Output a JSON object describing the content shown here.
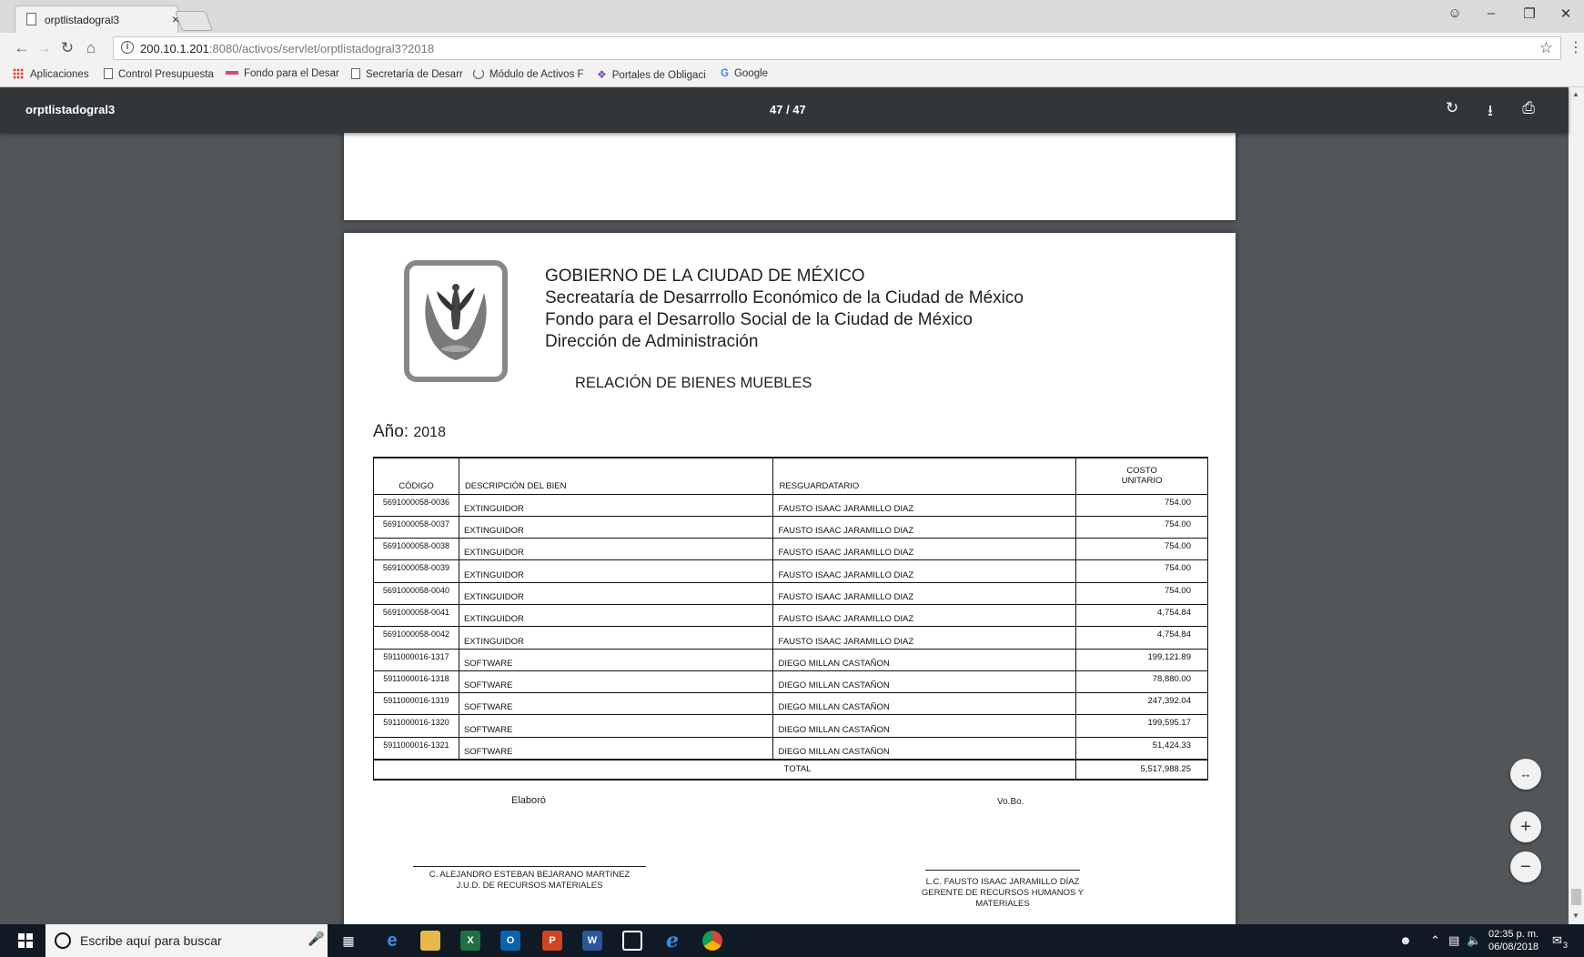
{
  "browser": {
    "tab_title": "orptlistadogral3",
    "tab_close": "×",
    "url_host": "200.10.1.201",
    "url_rest": ":8080/activos/servlet/orptlistadogral3?2018",
    "bookmarks": [
      {
        "label": "Aplicaciones",
        "icon": "apps-icon"
      },
      {
        "label": "Control Presupuesta",
        "icon": "page-icon"
      },
      {
        "label": "Fondo para el Desar",
        "icon": "fondeso-icon"
      },
      {
        "label": "Secretaría de Desarr",
        "icon": "page-icon"
      },
      {
        "label": "Módulo de Activos F",
        "icon": "loading-icon"
      },
      {
        "label": "Portales de Obligaci",
        "icon": "portal-icon"
      },
      {
        "label": "Google",
        "icon": "google-icon"
      }
    ]
  },
  "pdf": {
    "title": "orptlistadogral3",
    "page_indicator": "47 / 47"
  },
  "document": {
    "heading": [
      "GOBIERNO DE LA CIUDAD DE MÉXICO",
      "Secreataría de Desarrrollo Económico  de la Ciudad de México",
      "Fondo para el Desarrollo Social de la Ciudad de México",
      "Dirección de Administración"
    ],
    "report_title": "RELACIÓN DE BIENES MUEBLES",
    "year_label": "Año:",
    "year_value": "2018",
    "columns": {
      "code": "CÓDIGO",
      "description": "DESCRIPCIÓN DEL BIEN",
      "custodian": "RESGUARDATARIO",
      "cost_line1": "COSTO",
      "cost_line2": "UNITARIO"
    },
    "rows": [
      {
        "code": "5691000058-0036",
        "description": "EXTINGUIDOR",
        "custodian": "FAUSTO ISAAC JARAMILLO DIAZ",
        "cost": "754.00"
      },
      {
        "code": "5691000058-0037",
        "description": "EXTINGUIDOR",
        "custodian": "FAUSTO ISAAC JARAMILLO DIAZ",
        "cost": "754.00"
      },
      {
        "code": "5691000058-0038",
        "description": "EXTINGUIDOR",
        "custodian": "FAUSTO ISAAC JARAMILLO DIAZ",
        "cost": "754.00"
      },
      {
        "code": "5691000058-0039",
        "description": "EXTINGUIDOR",
        "custodian": "FAUSTO ISAAC JARAMILLO DIAZ",
        "cost": "754.00"
      },
      {
        "code": "5691000058-0040",
        "description": "EXTINGUIDOR",
        "custodian": "FAUSTO ISAAC JARAMILLO DIAZ",
        "cost": "754.00"
      },
      {
        "code": "5691000058-0041",
        "description": "EXTINGUIDOR",
        "custodian": "FAUSTO ISAAC JARAMILLO DIAZ",
        "cost": "4,754.84"
      },
      {
        "code": "5691000058-0042",
        "description": "EXTINGUIDOR",
        "custodian": "FAUSTO ISAAC JARAMILLO DIAZ",
        "cost": "4,754.84"
      },
      {
        "code": "5911000016-1317",
        "description": "SOFTWARE",
        "custodian": "DIEGO MILLAN CASTAÑON",
        "cost": "199,121.89"
      },
      {
        "code": "5911000016-1318",
        "description": "SOFTWARE",
        "custodian": "DIEGO MILLAN CASTAÑON",
        "cost": "78,880.00"
      },
      {
        "code": "5911000016-1319",
        "description": "SOFTWARE",
        "custodian": "DIEGO MILLAN CASTAÑON",
        "cost": "247,392.04"
      },
      {
        "code": "5911000016-1320",
        "description": "SOFTWARE",
        "custodian": "DIEGO MILLAN CASTAÑON",
        "cost": "199,595.17"
      },
      {
        "code": "5911000016-1321",
        "description": "SOFTWARE",
        "custodian": "DIEGO MILLAN CASTAÑON",
        "cost": "51,424.33"
      }
    ],
    "total_label": "TOTAL",
    "total_value": "5,517,988.25",
    "signatures": {
      "prepared_label": "Elaboró",
      "approved_label": "Vo.Bo.",
      "prepared_name": "C. ALEJANDRO ESTEBAN BEJARANO MARTINEZ",
      "prepared_title": "J.U.D. DE RECURSOS MATERIALES",
      "approved_name": "L.C. FAUSTO ISAAC JARAMILLO DÍAZ",
      "approved_title": "GERENTE DE RECURSOS HUMANOS Y MATERIALES"
    }
  },
  "taskbar": {
    "search_placeholder": "Escribe aquí para buscar",
    "time": "02:35 p. m.",
    "date": "06/08/2018",
    "notification_count": "3"
  },
  "colors": {
    "pdf_toolbar": "#323639",
    "viewer_bg": "#525659",
    "taskbar": "#101a24"
  }
}
